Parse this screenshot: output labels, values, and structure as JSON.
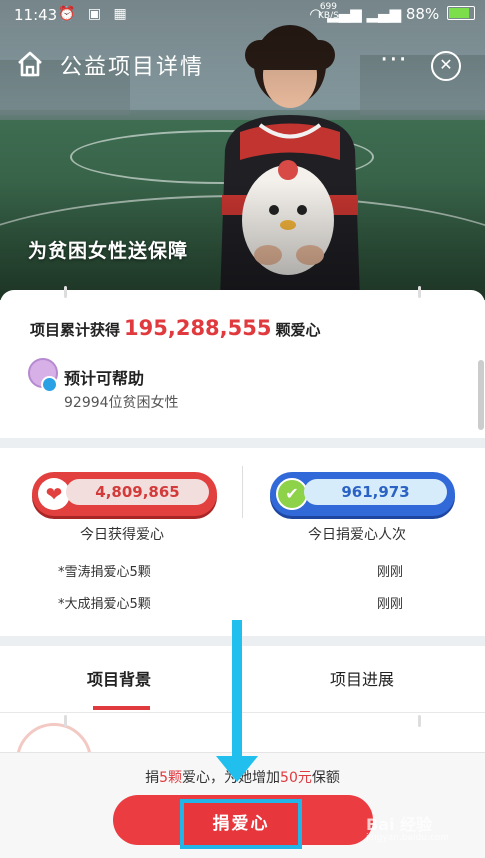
{
  "status_bar": {
    "time": "11:43",
    "speed": "699",
    "speed_unit": "KB/S",
    "battery": "88%"
  },
  "nav": {
    "title": "公益项目详情",
    "more": "···",
    "close": "✕"
  },
  "hero": {
    "caption": "为贫困女性送保障"
  },
  "stats": {
    "total_prefix": "项目累计获得",
    "total_value": "195,288,555",
    "total_suffix": "颗爱心",
    "help_title": "预计可帮助",
    "help_sub": "92994位贫困女性"
  },
  "today": {
    "hearts_value": "4,809,865",
    "hearts_label": "今日获得爱心",
    "donors_value": "961,973",
    "donors_label": "今日捐爱心人次",
    "donations": [
      {
        "name": "*雪涛捐爱心5颗",
        "time": "刚刚"
      },
      {
        "name": "*大成捐爱心5颗",
        "time": "刚刚"
      }
    ]
  },
  "tabs": [
    {
      "label": "项目背景",
      "active": true
    },
    {
      "label": "项目进展",
      "active": false
    }
  ],
  "bottom": {
    "promo_prefix": "捐",
    "promo_count": "5颗",
    "promo_mid": "爱心，为她增加",
    "promo_amount": "50元",
    "promo_suffix": "保额",
    "donate_label": "捐爱心"
  },
  "watermark": {
    "text": "Bai 经验",
    "sub": "jingyan.baidu.com"
  },
  "colors": {
    "accent_red": "#e0393e",
    "accent_blue": "#3169d9",
    "highlight_cyan": "#20bfee"
  }
}
